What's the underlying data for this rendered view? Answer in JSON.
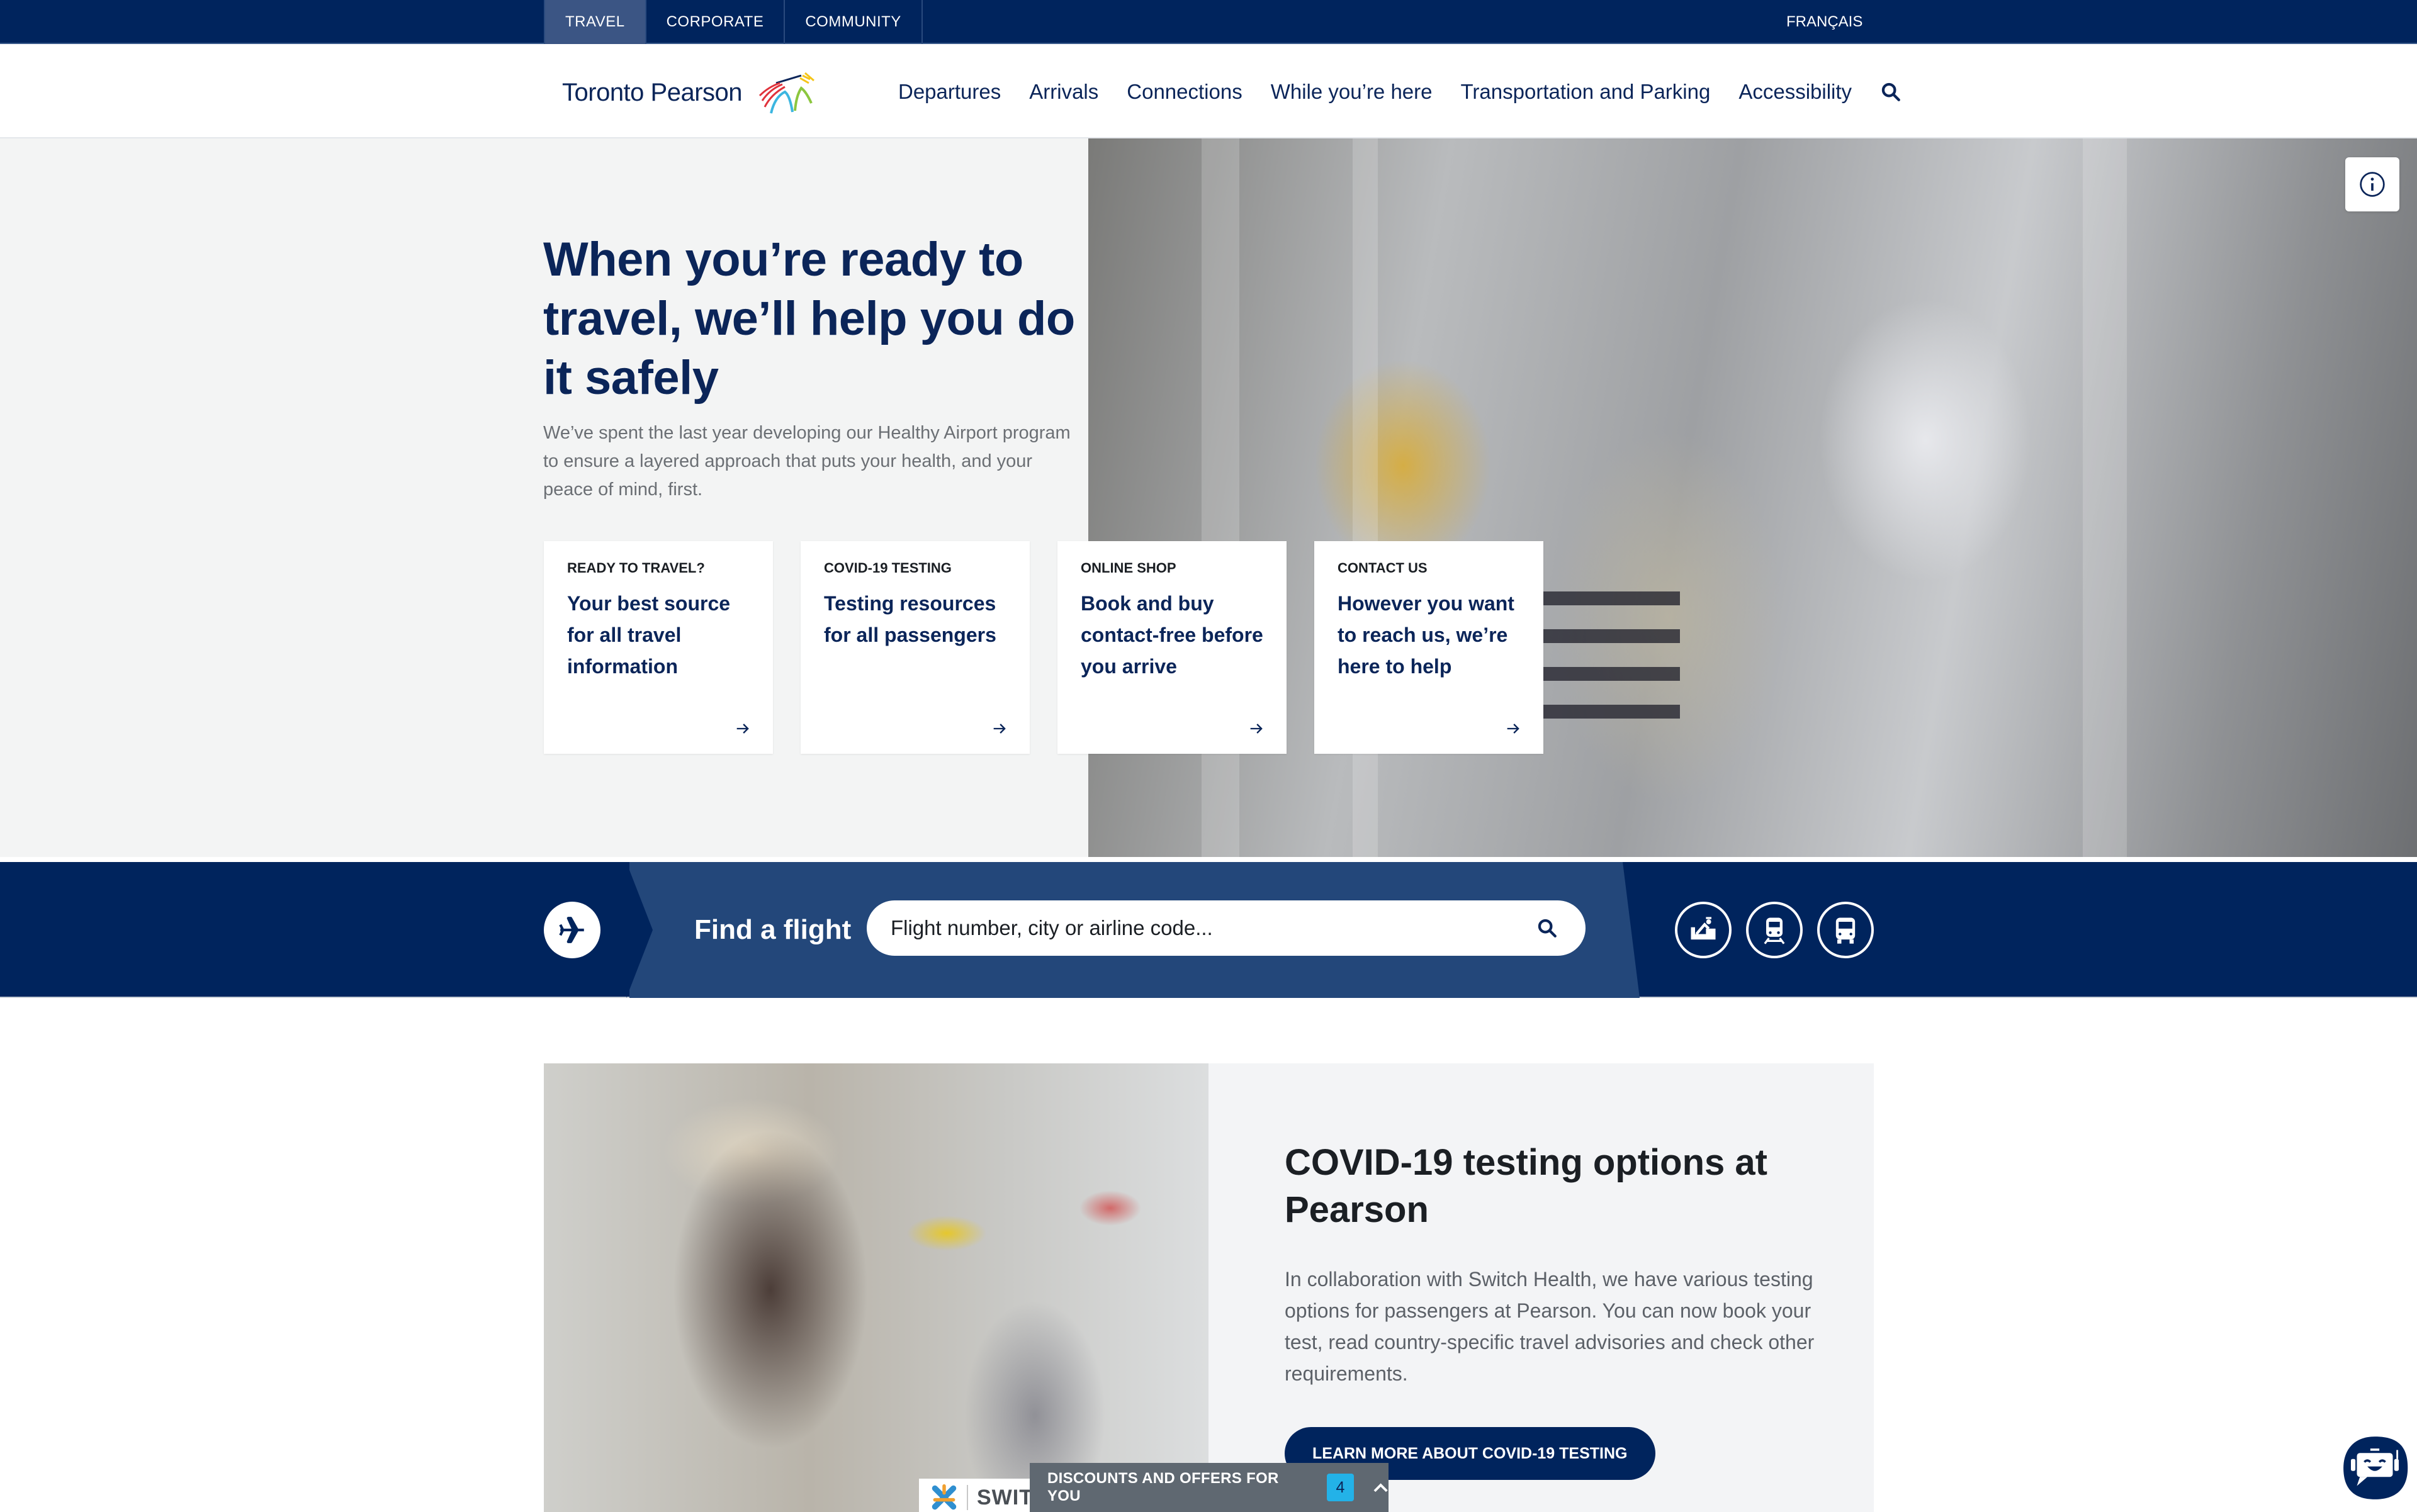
{
  "utility_bar": {
    "tabs": [
      {
        "label": "TRAVEL",
        "active": true
      },
      {
        "label": "CORPORATE",
        "active": false
      },
      {
        "label": "COMMUNITY",
        "active": false
      }
    ],
    "language_link": "FRANÇAIS"
  },
  "header": {
    "logo_text": "Toronto Pearson",
    "logo_icon": "pearson-logo-icon",
    "nav": [
      {
        "label": "Departures"
      },
      {
        "label": "Arrivals"
      },
      {
        "label": "Connections"
      },
      {
        "label": "While you’re here"
      },
      {
        "label": "Transportation and Parking"
      },
      {
        "label": "Accessibility"
      }
    ],
    "search_icon": "search-icon"
  },
  "hero": {
    "title": "When you’re ready to travel, we’ll help you do it safely",
    "description": "We’ve spent the last year developing our Healthy Airport program to ensure a layered approach that puts your health, and your peace of mind, first.",
    "info_icon": "info-icon",
    "cards": [
      {
        "eyebrow": "READY TO TRAVEL?",
        "title": "Your best source for all travel information",
        "icon": "arrow-right-icon"
      },
      {
        "eyebrow": "COVID-19 TESTING",
        "title": "Testing resources for all passengers",
        "icon": "arrow-right-icon"
      },
      {
        "eyebrow": "ONLINE SHOP",
        "title": "Book and buy contact-free before you arrive",
        "icon": "arrow-right-icon"
      },
      {
        "eyebrow": "CONTACT US",
        "title": "However you want to reach us, we’re here to help",
        "icon": "arrow-right-icon"
      }
    ]
  },
  "flight_search": {
    "label": "Find a flight",
    "placeholder": "Flight number, city or airline code...",
    "value": "",
    "icons": [
      "airplane-icon",
      "search-icon",
      "parking-attendant-icon",
      "train-icon",
      "bus-icon"
    ]
  },
  "covid_section": {
    "title": "COVID-19 testing options at Pearson",
    "description": "In collaboration with Switch Health, we have various testing options for passengers at Pearson. You can now book your test, read country-specific travel advisories and check other requirements.",
    "button_label": "LEARN MORE ABOUT COVID-19 TESTING",
    "partner_badge": "SWITCH HEALTH"
  },
  "offers_drawer": {
    "label": "DISCOUNTS AND OFFERS FOR YOU",
    "count": "4",
    "icon": "chevron-up-icon"
  },
  "chatbot": {
    "icon": "chatbot-icon"
  },
  "colors": {
    "navy": "#00245d",
    "panel_blue": "#23477a",
    "text_navy": "#0b2559",
    "badge_cyan": "#23b2e8",
    "hero_bg": "#f3f4f4",
    "drawer_gray": "#5f6871"
  }
}
